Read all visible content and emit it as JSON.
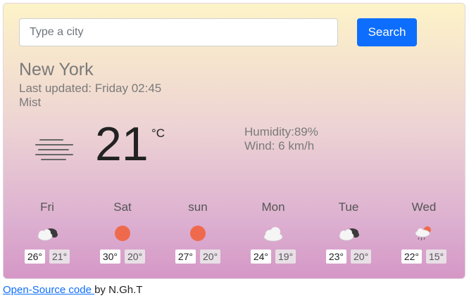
{
  "search": {
    "placeholder": "Type a city",
    "button_label": "Search"
  },
  "current": {
    "city": "New York",
    "updated": "Last updated: Friday 02:45",
    "condition": "Mist",
    "temperature": "21",
    "unit": "°C",
    "humidity": "Humidity:89%",
    "wind": "Wind: 6 km/h"
  },
  "forecast": [
    {
      "day": "Fri",
      "icon": "cloud-night-icon",
      "hi": "26°",
      "lo": "21°"
    },
    {
      "day": "Sat",
      "icon": "sun-icon",
      "hi": "30°",
      "lo": "20°"
    },
    {
      "day": "sun",
      "icon": "sun-icon",
      "hi": "27°",
      "lo": "20°"
    },
    {
      "day": "Mon",
      "icon": "cloud-icon",
      "hi": "24°",
      "lo": "19°"
    },
    {
      "day": "Tue",
      "icon": "cloud-night-icon",
      "hi": "23°",
      "lo": "20°"
    },
    {
      "day": "Wed",
      "icon": "rain-sun-icon",
      "hi": "22°",
      "lo": "15°"
    }
  ],
  "footer": {
    "link_text": "Open-Source code ",
    "author": "by N.Gh.T"
  },
  "colors": {
    "accent": "#0d6efd",
    "sun": "#ef6a4c",
    "cloud": "#f5f5f5",
    "dark_cloud": "#3a3a3a"
  }
}
